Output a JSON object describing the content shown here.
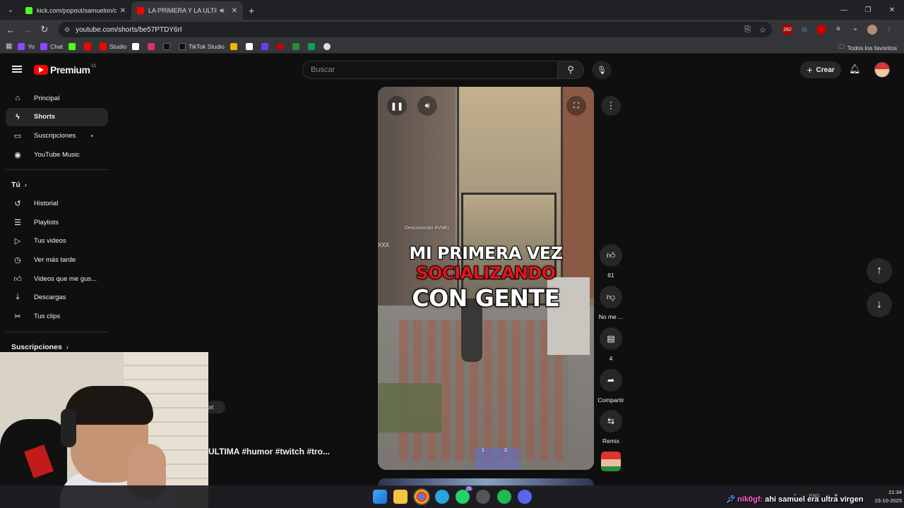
{
  "browser": {
    "tabs": [
      {
        "title": "kick.com/popout/samuelon/ch",
        "favicon_color": "#53fc18",
        "active": false
      },
      {
        "title": "LA PRIMERA Y LA ULTIMA",
        "favicon_color": "#ff0000",
        "active": true
      }
    ],
    "url": "youtube.com/shorts/be57PTDY6rI",
    "extension_badge": "282",
    "bookmarks": [
      {
        "label": "Yo",
        "color": "#9146ff"
      },
      {
        "label": "Chat",
        "color": "#9146ff"
      },
      {
        "label": "",
        "color": "#53fc18"
      },
      {
        "label": "",
        "color": "#ff0000"
      },
      {
        "label": "Studio",
        "color": "#ff0000"
      },
      {
        "label": "",
        "color": "#ffffff"
      },
      {
        "label": "",
        "color": "#e1306c"
      },
      {
        "label": "",
        "color": "#000000"
      },
      {
        "label": "TikTok Studio",
        "color": "#000000"
      }
    ],
    "all_bookmarks": "Todos los favoritos"
  },
  "youtube": {
    "logo_text": "Premium",
    "country_code": "CL",
    "search_placeholder": "Buscar",
    "create_label": "Crear"
  },
  "sidebar": {
    "main": [
      {
        "label": "Principal",
        "icon": "home-icon"
      },
      {
        "label": "Shorts",
        "icon": "shorts-icon",
        "active": true
      },
      {
        "label": "Suscripciones",
        "icon": "subscriptions-icon",
        "has_dot": true
      },
      {
        "label": "YouTube Music",
        "icon": "music-icon"
      }
    ],
    "you_title": "Tú",
    "you": [
      {
        "label": "Historial",
        "icon": "history-icon"
      },
      {
        "label": "Playlists",
        "icon": "playlists-icon"
      },
      {
        "label": "Tus videos",
        "icon": "your-videos-icon"
      },
      {
        "label": "Ver más tarde",
        "icon": "watch-later-icon"
      },
      {
        "label": "Videos que me gus...",
        "icon": "liked-icon"
      },
      {
        "label": "Descargas",
        "icon": "download-icon"
      },
      {
        "label": "Tus clips",
        "icon": "clips-icon"
      }
    ],
    "subs_title": "Suscripciones"
  },
  "short": {
    "overlay_line1": "MI PRIMERA VEZ",
    "overlay_line2": "SOCIALIZANDO",
    "overlay_line3": "CON GENTE",
    "nametag": "Desconocido #VNEI",
    "side_text": "XXX",
    "hotbar_1": "1",
    "hotbar_2": "2",
    "title_fragment": "ULTIMA #humor #twitch #tro...",
    "behind_pill": "ort"
  },
  "actions": {
    "like_count": "61",
    "dislike_label": "No me ...",
    "comment_count": "4",
    "share_label": "Compartir",
    "remix_label": "Remix"
  },
  "taskbar": {
    "badge": "25",
    "lang": "ENG",
    "time": "21:34",
    "date": "23-10-2025"
  },
  "chat_overlay": {
    "user": "nik0gf:",
    "message": "ahi samuel era ultra virgen"
  },
  "colors": {
    "accent_red": "#ff0000",
    "active_sidebar": "#272727",
    "overlay_red": "#e3151c"
  }
}
